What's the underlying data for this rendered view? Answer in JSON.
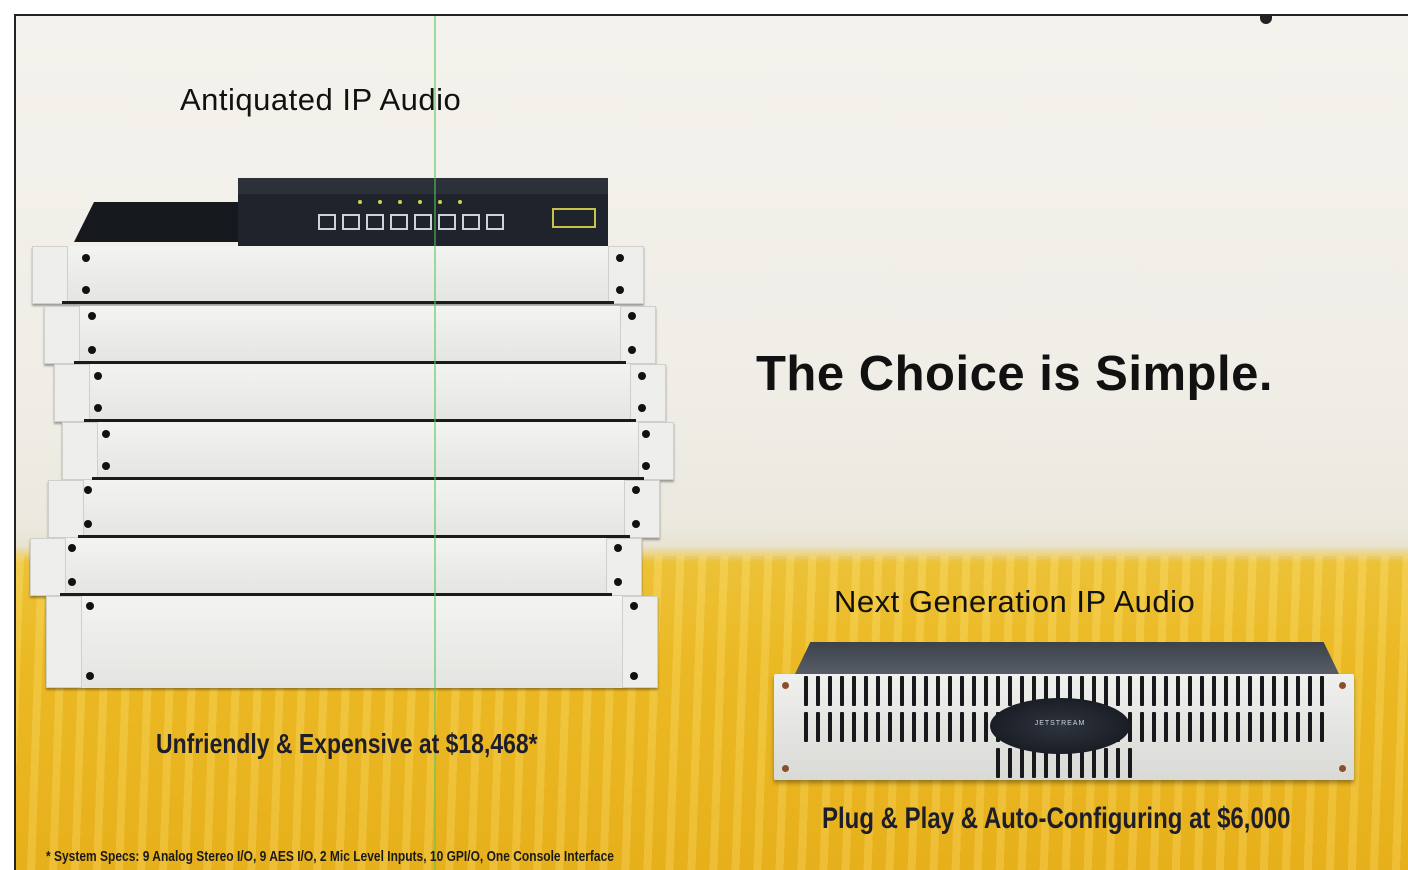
{
  "headline_left": "Antiquated IP Audio",
  "headline_main": "The Choice is Simple.",
  "headline_next": "Next Generation IP Audio",
  "price_left": "Unfriendly & Expensive at $18,468*",
  "price_right": "Plug & Play & Auto-Configuring at $6,000",
  "footnote": "* System Specs: 9 Analog Stereo I/O, 9 AES I/O, 2 Mic Level Inputs, 10 GPI/O, One Console Interface",
  "jetstream_badge": "JETSTREAM",
  "colors": {
    "table_yellow": "#eebd26",
    "backdrop": "#f0eee8",
    "text": "#111111"
  }
}
